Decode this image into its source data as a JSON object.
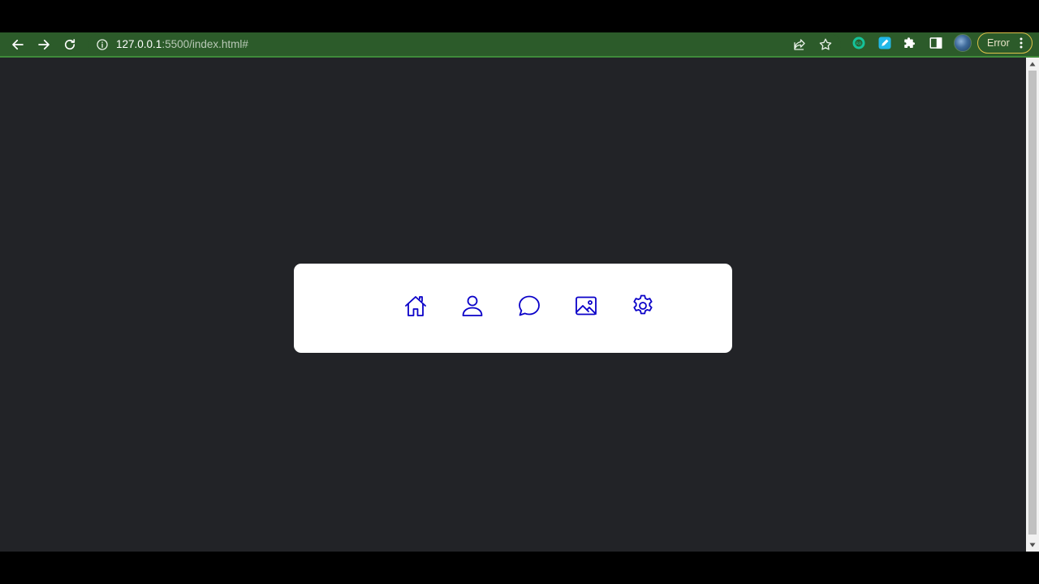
{
  "browser": {
    "url_host": "127.0.0.1",
    "url_path": ":5500/index.html#",
    "profile_status": "Error",
    "theme_color": "#2c5b2a",
    "status_color": "#e0c24a",
    "toolbar_icons": [
      "back-icon",
      "forward-icon",
      "reload-icon",
      "info-icon",
      "share-icon",
      "star-icon",
      "grammarly-icon",
      "pen-extension-icon",
      "puzzle-icon",
      "side-panel-icon",
      "avatar",
      "kebab-menu-icon"
    ]
  },
  "page": {
    "background": "#222327",
    "card_background": "#ffffff",
    "icon_color": "#0a00c8",
    "nav_items": [
      {
        "name": "home",
        "icon": "home-icon"
      },
      {
        "name": "profile",
        "icon": "person-icon"
      },
      {
        "name": "messages",
        "icon": "chat-icon"
      },
      {
        "name": "gallery",
        "icon": "image-icon"
      },
      {
        "name": "settings",
        "icon": "gear-icon"
      }
    ]
  }
}
